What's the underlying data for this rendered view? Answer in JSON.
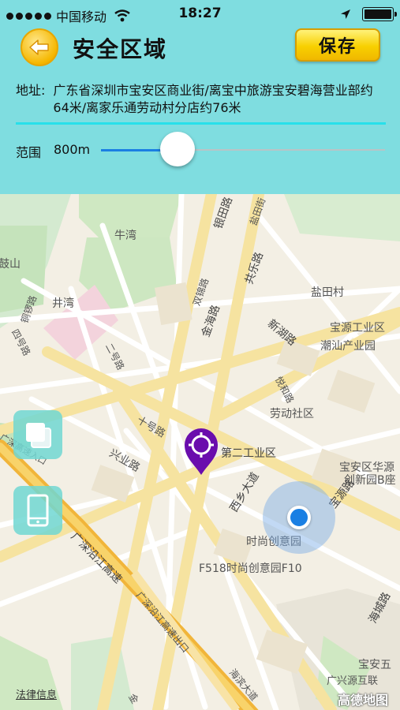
{
  "status_bar": {
    "carrier": "中国移动",
    "time": "18:27"
  },
  "header": {
    "title": "安全区域",
    "save_label": "保存",
    "back_icon": "back-arrow-icon"
  },
  "address": {
    "label": "地址:",
    "text": "广东省深圳市宝安区商业街/离宝中旅游宝安碧海营业部约64米/离家乐通劳动村分店约76米"
  },
  "range": {
    "label": "范围",
    "value": "800m",
    "slider_fraction": 0.27
  },
  "colors": {
    "panel_bg": "#7fdde0",
    "accent_blue": "#1a7fe3",
    "divider": "#27e0ea",
    "pin_purple": "#6a0dad"
  },
  "map": {
    "labels": {
      "niuwan": "牛湾",
      "jingwan": "井湾",
      "tongluo_road": "铜锣路",
      "sihao_road": "四号路",
      "erhao_road": "二号路",
      "shihao_road": "十号路",
      "xingye_road": "兴业路",
      "gaosu_entrance": "广深高速入口",
      "shuangjin_road": "双锦路",
      "jinhai_road": "金海路",
      "yintian_road": "银田路",
      "yintian_street": "盐田街",
      "gongle_road": "共乐路",
      "yantian_village": "盐田村",
      "xinhu_road": "新湖路",
      "baoyuan_industrial": "宝源工业区",
      "chaoshan_industrial": "潮汕产业园",
      "yuehe_road": "悦和路",
      "laodong_community": "劳动社区",
      "dier_industrial": "第二工业区",
      "xixiang_avenue": "西乡大道",
      "baoan_huachuang": "宝安区华源",
      "chuangxin_park": "创新园B座",
      "baoyuan_road": "宝源路",
      "shishang_park": "时尚创意园",
      "f518": "F518时尚创意园F10",
      "yanjiang_expressway": "广深沿江高速",
      "yanjiang_exit": "广深沿江高速出口",
      "haicheng_road": "海城路",
      "haibin_avenue": "海滨大道",
      "baoan_wu": "宝安五",
      "guangxing": "广兴源互联",
      "jin": "金",
      "gu_shan": "鼓山"
    },
    "legal": "法律信息",
    "brand": "高德地图",
    "layers_icon": "layers-icon",
    "device_icon": "phone-device-icon",
    "pin_icon": "map-pin-icon",
    "location_icon": "current-location-icon"
  }
}
